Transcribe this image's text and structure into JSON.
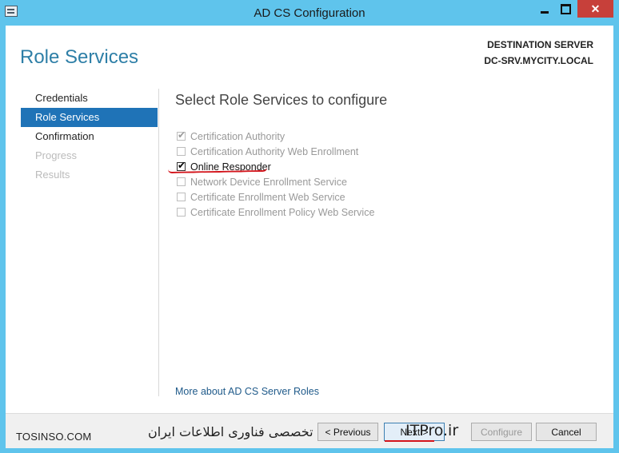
{
  "window": {
    "title": "AD CS Configuration"
  },
  "header": {
    "page_title": "Role Services",
    "destination_label": "DESTINATION SERVER",
    "destination_server": "DC-SRV.MYCITY.LOCAL"
  },
  "nav": {
    "items": [
      {
        "label": "Credentials",
        "state": "normal"
      },
      {
        "label": "Role Services",
        "state": "active"
      },
      {
        "label": "Confirmation",
        "state": "normal"
      },
      {
        "label": "Progress",
        "state": "disabled"
      },
      {
        "label": "Results",
        "state": "disabled"
      }
    ]
  },
  "main": {
    "section_title": "Select Role Services to configure",
    "services": [
      {
        "label": "Certification Authority",
        "checked": true,
        "enabled": false
      },
      {
        "label": "Certification Authority Web Enrollment",
        "checked": false,
        "enabled": false
      },
      {
        "label": "Online Responder",
        "checked": true,
        "enabled": true
      },
      {
        "label": "Network Device Enrollment Service",
        "checked": false,
        "enabled": false
      },
      {
        "label": "Certificate Enrollment Web Service",
        "checked": false,
        "enabled": false
      },
      {
        "label": "Certificate Enrollment Policy Web Service",
        "checked": false,
        "enabled": false
      }
    ],
    "more_link": "More about AD CS Server Roles"
  },
  "footer": {
    "watermark_left": "TOSINSO.COM",
    "watermark_fa": "وب سایت تخصصی فناوری اطلاعات ایران",
    "watermark_it": "ITPro.ir",
    "previous_label": "< Previous",
    "next_label": "Next >",
    "configure_label": "Configure",
    "cancel_label": "Cancel"
  },
  "colors": {
    "accent": "#1f73b7",
    "title_bar": "#5fc4ec",
    "close": "#c7403a",
    "annotation": "#d3141b"
  }
}
